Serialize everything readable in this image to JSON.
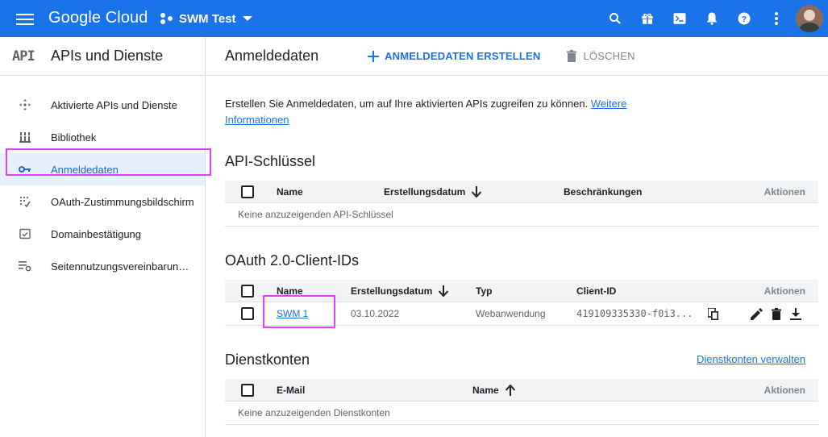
{
  "topbar": {
    "brand": "Google Cloud",
    "project": "SWM Test",
    "icons": [
      "search-icon",
      "gift-icon",
      "cloud-shell-icon",
      "notifications-icon",
      "help-icon",
      "more-vert-icon"
    ]
  },
  "sidebar": {
    "logo": "API",
    "title": "APIs und Dienste",
    "items": [
      {
        "label": "Aktivierte APIs und Dienste",
        "icon": "apis-services-icon"
      },
      {
        "label": "Bibliothek",
        "icon": "library-icon"
      },
      {
        "label": "Anmeldedaten",
        "icon": "key-icon"
      },
      {
        "label": "OAuth-Zustimmungsbildschirm",
        "icon": "oauth-consent-icon"
      },
      {
        "label": "Domainbestätigung",
        "icon": "domain-verification-icon"
      },
      {
        "label": "Seitennutzungsvereinbarungen",
        "icon": "settings-list-icon"
      }
    ],
    "active_index": 2
  },
  "main": {
    "title": "Anmeldedaten",
    "create_label": "ANMELDEDATEN ERSTELLEN",
    "delete_label": "LÖSCHEN",
    "description": "Erstellen Sie Anmeldedaten, um auf Ihre aktivierten APIs zugreifen zu können.",
    "more_info_line1": "Weitere",
    "more_info_line2": "Informationen",
    "api_keys": {
      "title": "API-Schlüssel",
      "columns": [
        "Name",
        "Erstellungsdatum",
        "Beschränkungen",
        "Aktionen"
      ],
      "empty": "Keine anzuzeigenden API-Schlüssel"
    },
    "oauth": {
      "title": "OAuth 2.0-Client-IDs",
      "columns": [
        "Name",
        "Erstellungsdatum",
        "Typ",
        "Client-ID",
        "Aktionen"
      ],
      "rows": [
        {
          "name": "SWM 1",
          "date": "03.10.2022",
          "type": "Webanwendung",
          "client_id": "419109335330-f0i3..."
        }
      ]
    },
    "service_accounts": {
      "title": "Dienstkonten",
      "manage_label": "Dienstkonten verwalten",
      "columns": [
        "E-Mail",
        "Name",
        "Aktionen"
      ],
      "empty": "Keine anzuzeigenden Dienstkonten"
    }
  },
  "colors": {
    "accent": "#1a73e8",
    "highlight": "#e040fb"
  }
}
